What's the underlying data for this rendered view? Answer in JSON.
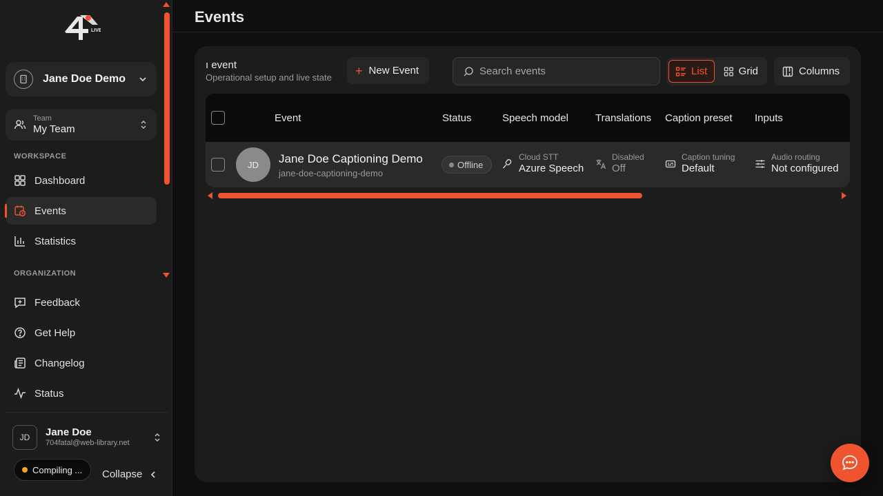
{
  "sidebar": {
    "org": {
      "name": "Jane Doe Demo"
    },
    "team": {
      "label": "Team",
      "name": "My Team"
    },
    "workspace_label": "WORKSPACE",
    "workspace_items": [
      {
        "label": "Dashboard",
        "icon": "dashboard-icon"
      },
      {
        "label": "Events",
        "icon": "calendar-clock-icon",
        "active": true
      },
      {
        "label": "Statistics",
        "icon": "bar-chart-icon"
      }
    ],
    "organization_label": "ORGANIZATION",
    "organization_items": [
      {
        "label": "Feedback",
        "icon": "message-plus-icon"
      },
      {
        "label": "Get Help",
        "icon": "help-circle-icon"
      },
      {
        "label": "Changelog",
        "icon": "newspaper-icon"
      },
      {
        "label": "Status",
        "icon": "activity-icon"
      }
    ],
    "user": {
      "initials": "JD",
      "name": "Jane Doe",
      "email": "704fatal@web-library.net"
    },
    "compiling_label": "Compiling ...",
    "collapse_label": "Collapse"
  },
  "header": {
    "title": "Events"
  },
  "panel": {
    "title": "ı event",
    "subtitle": "Operational setup and live state",
    "new_event_label": "New Event",
    "search_placeholder": "Search events",
    "view_list_label": "List",
    "view_grid_label": "Grid",
    "columns_label": "Columns"
  },
  "table": {
    "columns": [
      "Event",
      "Status",
      "Speech model",
      "Translations",
      "Caption preset",
      "Inputs"
    ],
    "rows": [
      {
        "initials": "JD",
        "name": "Jane Doe Captioning Demo",
        "slug": "jane-doe-captioning-demo",
        "status": "Offline",
        "speech_label": "Cloud STT",
        "speech_value": "Azure Speech",
        "translations_label": "Disabled",
        "translations_value": "Off",
        "caption_label": "Caption tuning",
        "caption_value": "Default",
        "inputs_label": "Audio routing",
        "inputs_value": "Not configured"
      }
    ]
  },
  "colors": {
    "accent": "#f0532f",
    "background": "#0f0f0f",
    "sidebar": "#1c1c1c",
    "panel": "#1c1c1c",
    "compiling_dot": "#f5a524"
  },
  "icons": {
    "chat": "chat-bubble-icon",
    "search": "search-icon",
    "plus": "plus-icon"
  }
}
